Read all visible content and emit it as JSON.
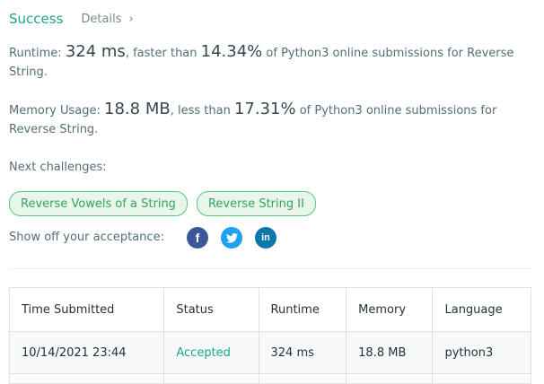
{
  "header": {
    "status": "Success",
    "details_label": "Details",
    "details_chevron": "›"
  },
  "runtime": {
    "label": "Runtime: ",
    "value": "324 ms",
    "middle": ", faster than ",
    "percent": "14.34%",
    "suffix": " of Python3 online submissions for Reverse String."
  },
  "memory": {
    "label": "Memory Usage: ",
    "value": "18.8 MB",
    "middle": ", less than ",
    "percent": "17.31%",
    "suffix": " of Python3 online submissions for Reverse String."
  },
  "next_challenges": {
    "label": "Next challenges:",
    "items": [
      "Reverse Vowels of a String",
      "Reverse String II"
    ]
  },
  "share": {
    "label": "Show off your acceptance:",
    "facebook_glyph": "f",
    "linkedin_glyph": "in",
    "colors": {
      "facebook": "#3b5998",
      "twitter": "#1da1f2",
      "linkedin": "#0e76a8"
    }
  },
  "submissions": {
    "columns": [
      "Time Submitted",
      "Status",
      "Runtime",
      "Memory",
      "Language"
    ],
    "rows": [
      {
        "time": "10/14/2021 23:44",
        "status": "Accepted",
        "runtime": "324 ms",
        "memory": "18.8 MB",
        "language": "python3"
      }
    ]
  },
  "colors": {
    "accent": "#1ba686",
    "chip_border": "#5cc77e",
    "chip_bg": "#e8f6ec"
  }
}
